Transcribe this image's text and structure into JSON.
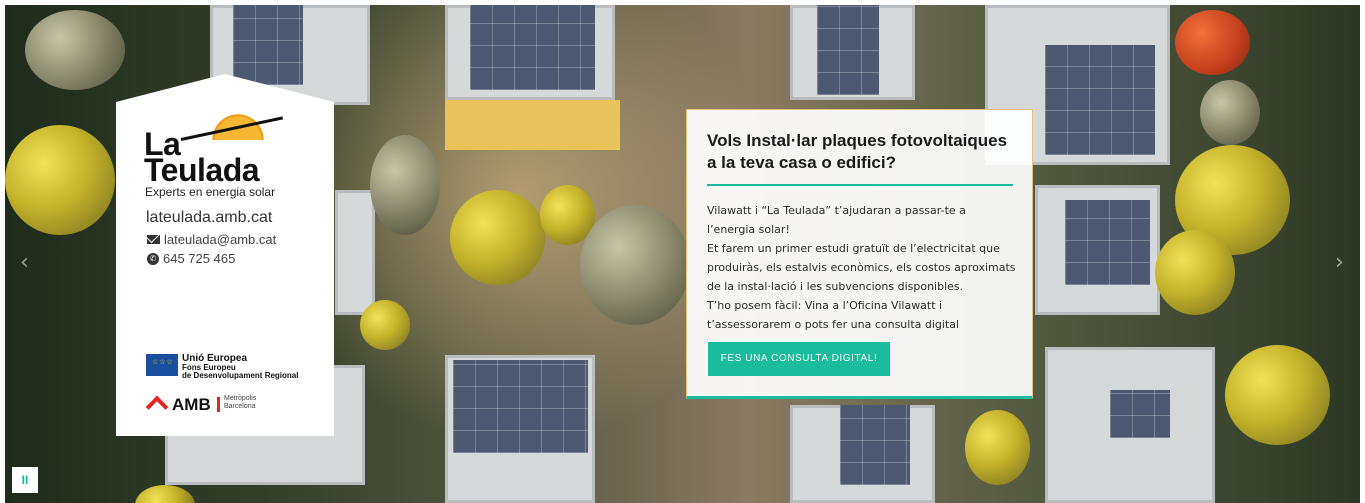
{
  "hero": {
    "nav": {
      "prev_icon": "chevron-left-icon",
      "next_icon": "chevron-right-icon",
      "prev_glyph": "‹",
      "next_glyph": "›"
    },
    "pause": {
      "icon": "pause-icon",
      "glyph": "II"
    }
  },
  "brand": {
    "logo_line1": "La",
    "logo_line2": "Teulada",
    "tagline": "Experts en energia solar",
    "website": "lateulada.amb.cat",
    "email": "lateulada@amb.cat",
    "phone": "645 725 465",
    "eu_title": "Unió Europea",
    "eu_sub1": "Fons Europeu",
    "eu_sub2": "de Desenvolupament Regional",
    "amb_name": "AMB",
    "amb_sub1": "Metròpolis",
    "amb_sub2": "Barcelona"
  },
  "info": {
    "title": "Vols Instal·lar plaques fotovoltaiques a la teva casa o edifici?",
    "body": [
      "Vilawatt i “La Teulada” t’ajudaran a passar-te a l’energia solar!",
      "Et farem un primer estudi gratuït de l’electricitat que produiràs, els estalvis econòmics, els costos aproximats de la instal·lació i les subvencions disponibles.",
      "T’ho posem fàcil: Vina a l’Oficina Vilawatt i t’assessorarem o pots fer una consulta digital"
    ],
    "cta_label": "FES UNA CONSULTA DIGITAL!"
  },
  "colors": {
    "accent": "#1abc9c",
    "amb_red": "#e3261f",
    "eu_blue": "#1a4fa0"
  }
}
